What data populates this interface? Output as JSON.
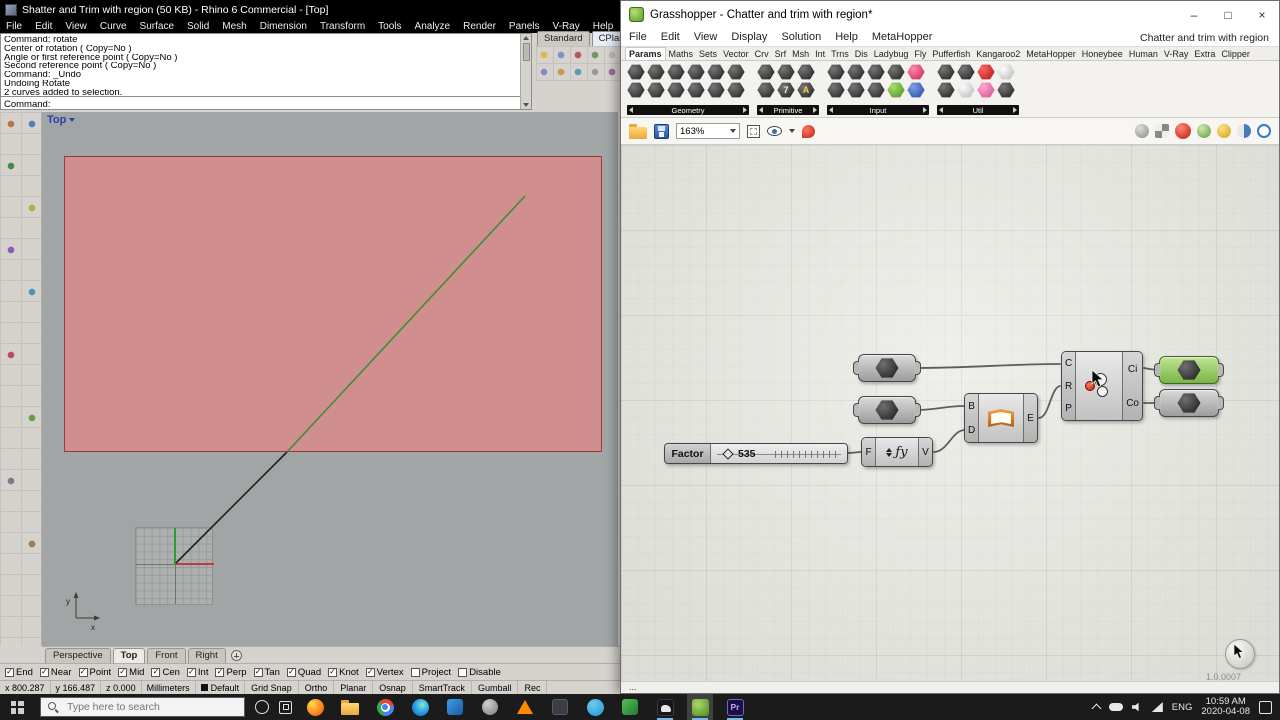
{
  "rhino": {
    "title": "Shatter and Trim with region (50 KB) - Rhino 6 Commercial - [Top]",
    "menu": [
      "File",
      "Edit",
      "View",
      "Curve",
      "Surface",
      "Solid",
      "Mesh",
      "Dimension",
      "Transform",
      "Tools",
      "Analyze",
      "Render",
      "Panels",
      "V-Ray",
      "Help"
    ],
    "command_lines": [
      "Command: rotate",
      "Center of rotation ( Copy=No )",
      "Angle or first reference point ( Copy=No )",
      "Second reference point ( Copy=No )",
      "Command: _Undo",
      "Undoing Rotate",
      "2 curves added to selection."
    ],
    "command_prompt": "Command:",
    "toolbar_tabs": [
      {
        "label": "Standard"
      },
      {
        "label": "CPlanes",
        "active": true
      }
    ],
    "viewport_label": "Top",
    "axis_labels": {
      "x": "x",
      "y": "y"
    },
    "viewport_tabs": [
      {
        "label": "Perspective"
      },
      {
        "label": "Top",
        "active": true
      },
      {
        "label": "Front"
      },
      {
        "label": "Right"
      }
    ],
    "osnap_items": [
      {
        "label": "End",
        "checked": true
      },
      {
        "label": "Near",
        "checked": true
      },
      {
        "label": "Point",
        "checked": true
      },
      {
        "label": "Mid",
        "checked": true
      },
      {
        "label": "Cen",
        "checked": true
      },
      {
        "label": "Int",
        "checked": true
      },
      {
        "label": "Perp",
        "checked": true
      },
      {
        "label": "Tan",
        "checked": true
      },
      {
        "label": "Quad",
        "checked": true
      },
      {
        "label": "Knot",
        "checked": true
      },
      {
        "label": "Vertex",
        "checked": true
      },
      {
        "label": "Project",
        "checked": false
      },
      {
        "label": "Disable",
        "checked": false
      }
    ],
    "status": {
      "x": "x 800.287",
      "y": "y 166.487",
      "z": "z 0.000",
      "units": "Millimeters",
      "layer": "Default",
      "toggles": [
        "Grid Snap",
        "Ortho",
        "Planar",
        "Osnap",
        "SmartTrack",
        "Gumball",
        "Rec"
      ]
    }
  },
  "grasshopper": {
    "title": "Grasshopper - Chatter and trim with region*",
    "window_controls": {
      "minimize": "–",
      "maximize": "□",
      "close": "×"
    },
    "menu": [
      "File",
      "Edit",
      "View",
      "Display",
      "Solution",
      "Help",
      "MetaHopper"
    ],
    "doc_name": "Chatter and trim with region",
    "tabs": [
      {
        "label": "Params",
        "active": true
      },
      {
        "label": "Maths"
      },
      {
        "label": "Sets"
      },
      {
        "label": "Vector"
      },
      {
        "label": "Crv"
      },
      {
        "label": "Srf"
      },
      {
        "label": "Msh"
      },
      {
        "label": "Int"
      },
      {
        "label": "Trns"
      },
      {
        "label": "Dis"
      },
      {
        "label": "Ladybug"
      },
      {
        "label": "Fly"
      },
      {
        "label": "Pufferfish"
      },
      {
        "label": "Kangaroo2"
      },
      {
        "label": "MetaHopper"
      },
      {
        "label": "Honeybee"
      },
      {
        "label": "Human"
      },
      {
        "label": "V-Ray"
      },
      {
        "label": "Extra"
      },
      {
        "label": "Clipper"
      }
    ],
    "palette_groups": [
      "Geometry",
      "Primitive",
      "Input",
      "Util"
    ],
    "palette_glyphs": {
      "integer": "7",
      "text": "A"
    },
    "zoom": "163%",
    "canvas": {
      "slider": {
        "name": "Factor",
        "value": "535"
      },
      "expression": {
        "input": "F",
        "icon": "ƒy",
        "output": "V"
      },
      "book": {
        "input_top": "B",
        "input_bottom": "D",
        "output": "E"
      },
      "trim": {
        "input_curve": "C",
        "input_region": "R",
        "input_plane": "P",
        "output_inside": "Ci",
        "output_outside": "Co"
      },
      "version": "1.0.0007"
    },
    "status_ellipsis": "..."
  },
  "taskbar": {
    "search_placeholder": "Type here to search",
    "premiere_label": "Pr",
    "tray": {
      "lang": "ENG",
      "time": "10:59 AM",
      "date": "2020-04-08"
    }
  }
}
